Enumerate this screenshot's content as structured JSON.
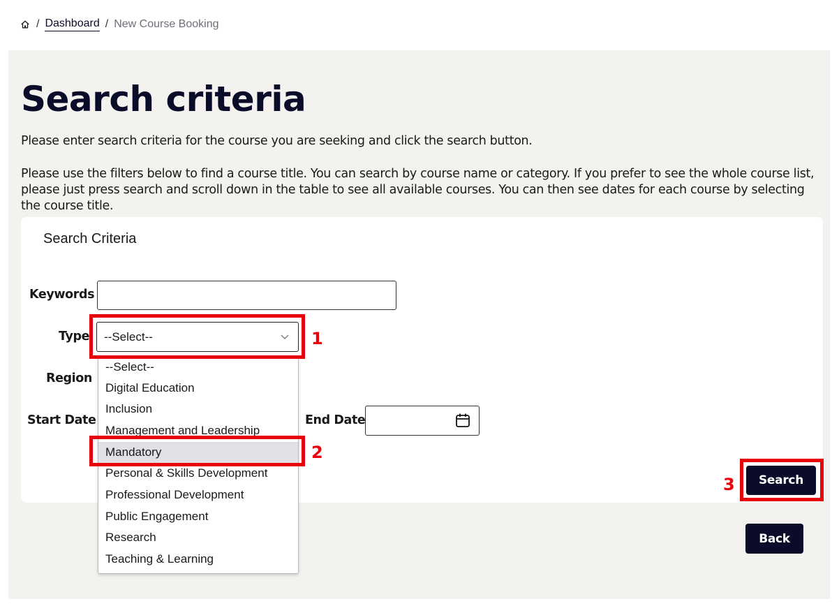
{
  "breadcrumb": {
    "home_icon": "home-icon",
    "separator": "/",
    "link": "Dashboard",
    "current": "New Course Booking"
  },
  "page": {
    "title": "Search criteria",
    "intro1": "Please enter search criteria for the course you are seeking and click the search button.",
    "intro2": "Please use the filters below to find a course title. You can search by course name or category. If you prefer to see the whole course list, please just press search and scroll down in the table to see all available courses. You can then see dates for each course by selecting the course title."
  },
  "form": {
    "card_title": "Search Criteria",
    "keywords_label": "Keywords",
    "keywords_value": "",
    "type_label": "Type",
    "type_selected": "--Select--",
    "region_label": "Region",
    "start_date_label": "Start Date",
    "end_date_label": "End Date",
    "end_date_value": "",
    "calendar_icon": "calendar-icon"
  },
  "type_options": [
    "--Select--",
    "Digital Education",
    "Inclusion",
    "Management and Leadership",
    "Mandatory",
    "Personal & Skills Development",
    "Professional Development",
    "Public Engagement",
    "Research",
    "Teaching & Learning"
  ],
  "highlighted_option": "Mandatory",
  "buttons": {
    "search": "Search",
    "back": "Back"
  },
  "annotations": {
    "n1": "1",
    "n2": "2",
    "n3": "3",
    "color": "#e8000b"
  },
  "colors": {
    "brand_navy": "#0b0c2a",
    "panel_bg": "#f3f2ee",
    "option_highlight": "#e1e0e6"
  }
}
